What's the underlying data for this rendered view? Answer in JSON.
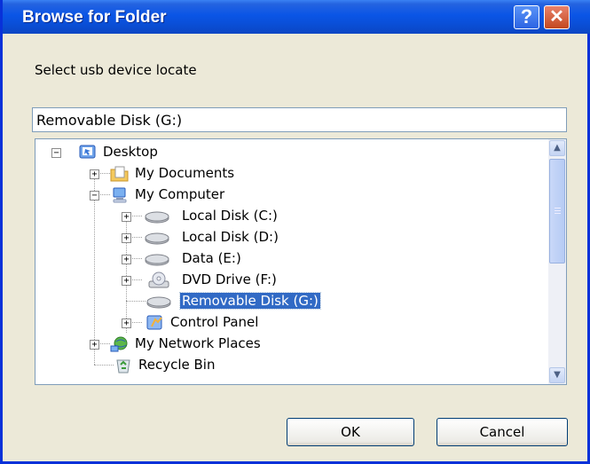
{
  "window": {
    "title": "Browse for Folder",
    "help_glyph": "?",
    "close_glyph": "✕"
  },
  "prompt": "Select usb device locate",
  "path_value": "Removable Disk (G:)",
  "tree": [
    {
      "label": "Desktop",
      "icon": "desktop-icon",
      "expander": "−"
    },
    {
      "label": "My Documents",
      "icon": "my-documents-icon",
      "expander": "+"
    },
    {
      "label": "My Computer",
      "icon": "my-computer-icon",
      "expander": "−"
    },
    {
      "label": "Local Disk (C:)",
      "icon": "hard-drive-icon",
      "expander": "+"
    },
    {
      "label": "Local Disk (D:)",
      "icon": "hard-drive-icon",
      "expander": "+"
    },
    {
      "label": "Data (E:)",
      "icon": "hard-drive-icon",
      "expander": "+"
    },
    {
      "label": "DVD Drive (F:)",
      "icon": "dvd-drive-icon",
      "expander": "+"
    },
    {
      "label": "Removable Disk (G:)",
      "icon": "removable-disk-icon",
      "expander": "",
      "selected": true
    },
    {
      "label": "Control Panel",
      "icon": "control-panel-icon",
      "expander": "+"
    },
    {
      "label": "My Network Places",
      "icon": "network-places-icon",
      "expander": "+"
    },
    {
      "label": "Recycle Bin",
      "icon": "recycle-bin-icon",
      "expander": ""
    }
  ],
  "buttons": {
    "ok": "OK",
    "cancel": "Cancel"
  },
  "scroll": {
    "up_glyph": "▲",
    "down_glyph": "▼"
  },
  "colors": {
    "titlebar": "#0a55e6",
    "selection": "#316ac5",
    "dialog_bg": "#ece9d8"
  }
}
